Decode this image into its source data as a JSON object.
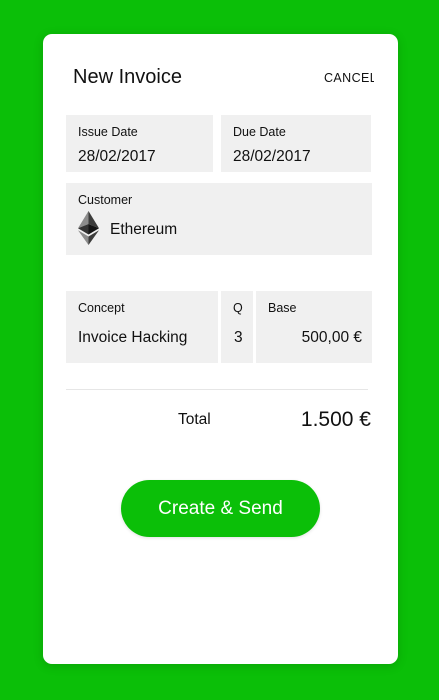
{
  "colors": {
    "background": "#0bbf08",
    "card": "#ffffff",
    "field_bg": "#f0f0f0",
    "button": "#0bbf08",
    "button_text": "#ffffff"
  },
  "header": {
    "title": "New Invoice",
    "cancel_label": "CANCEL"
  },
  "dates": {
    "issue_label": "Issue Date",
    "issue_value": "28/02/2017",
    "due_label": "Due Date",
    "due_value": "28/02/2017"
  },
  "customer": {
    "label": "Customer",
    "value": "Ethereum",
    "icon": "ethereum-icon"
  },
  "line_item": {
    "concept_label": "Concept",
    "concept_value": "Invoice Hacking",
    "qty_label": "Q",
    "qty_value": "3",
    "base_label": "Base",
    "base_value": "500,00 €"
  },
  "total": {
    "label": "Total",
    "value": "1.500 €"
  },
  "actions": {
    "create_label": "Create & Send"
  }
}
